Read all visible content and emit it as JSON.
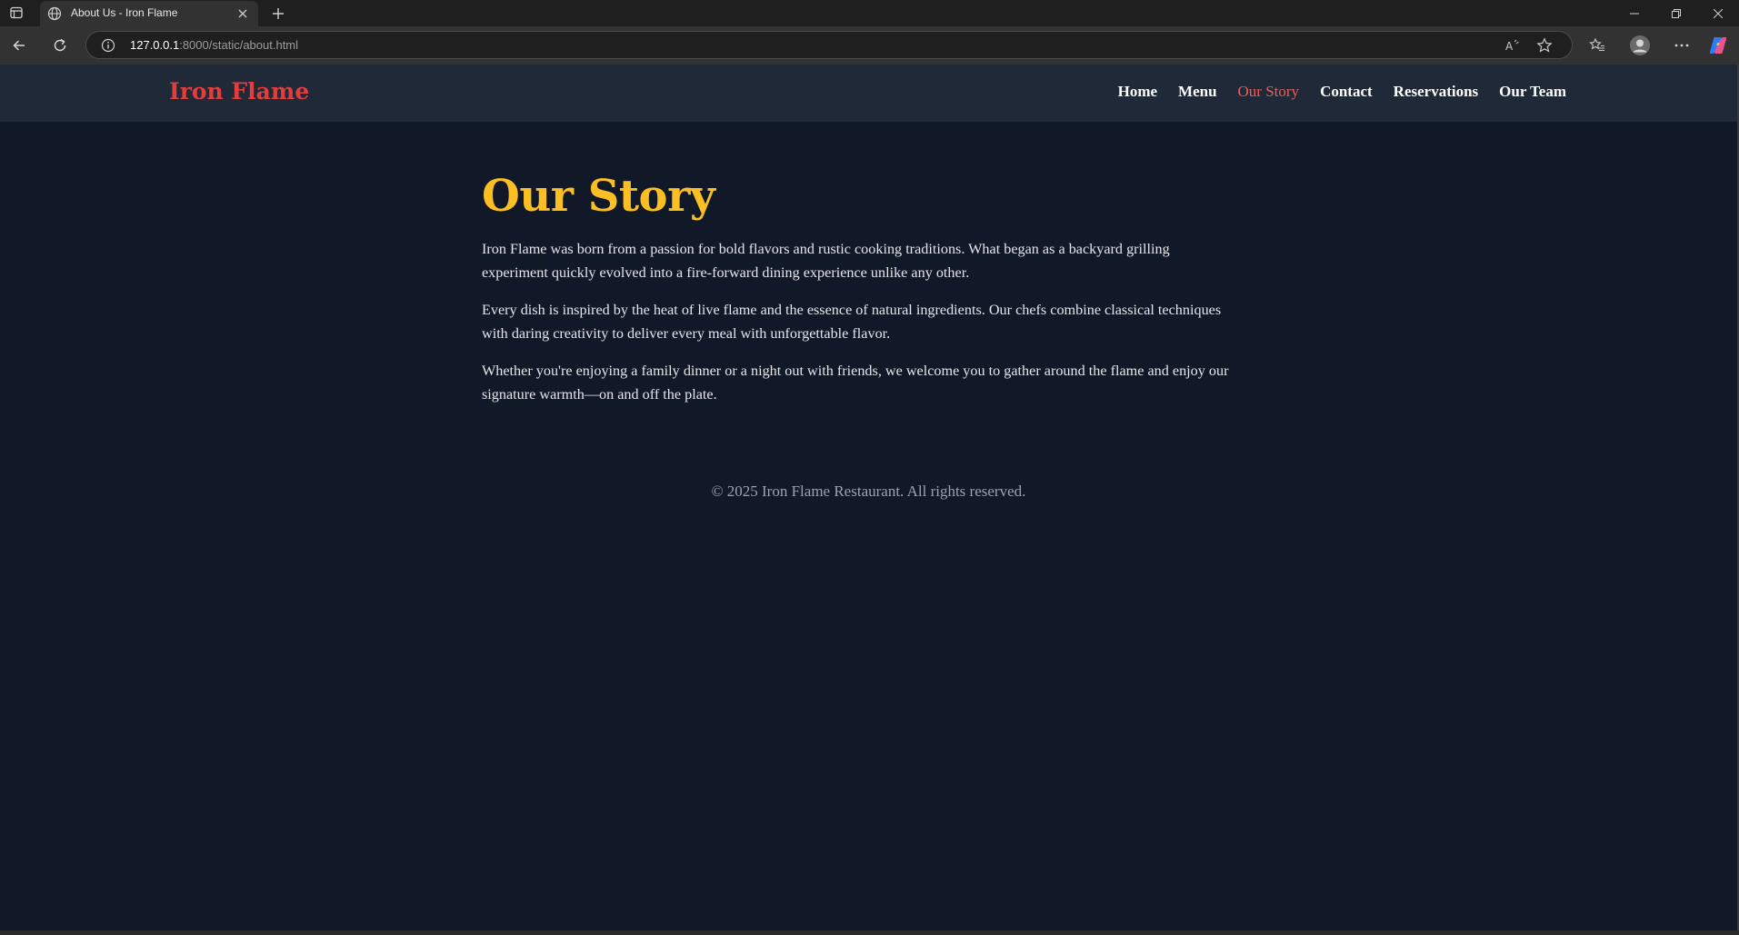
{
  "browser": {
    "tab_title": "About Us - Iron Flame",
    "url_host": "127.0.0.1",
    "url_rest": ":8000/static/about.html"
  },
  "site": {
    "logo": "Iron Flame",
    "nav": [
      "Home",
      "Menu",
      "Our Story",
      "Contact",
      "Reservations",
      "Our Team"
    ],
    "active_nav": "Our Story"
  },
  "main": {
    "heading": "Our Story",
    "paragraphs": [
      "Iron Flame was born from a passion for bold flavors and rustic cooking traditions. What began as a backyard grilling experiment quickly evolved into a fire-forward dining experience unlike any other.",
      "Every dish is inspired by the heat of live flame and the essence of natural ingredients. Our chefs combine classical techniques with daring creativity to deliver every meal with unforgettable flavor.",
      "Whether you're enjoying a family dinner or a night out with friends, we welcome you to gather around the flame and enjoy our signature warmth—on and off the plate."
    ]
  },
  "footer": {
    "text": "© 2025 Iron Flame Restaurant. All rights reserved."
  },
  "colors": {
    "page_bg": "#111827",
    "header_bg": "#1f2937",
    "logo": "#e23d3d",
    "heading": "#fbbf24",
    "nav_active": "#f15b5b"
  },
  "icons": {
    "tab_actions": "tab-actions-icon",
    "favicon": "globe-icon",
    "tab_close": "close-icon",
    "new_tab": "plus-icon",
    "back": "back-arrow-icon",
    "reload": "reload-icon",
    "site_info": "info-icon",
    "read_aloud": "read-aloud-icon",
    "favorite": "star-icon",
    "favorites": "favorites-icon",
    "profile": "profile-icon",
    "more": "more-icon",
    "copilot": "copilot-icon"
  }
}
